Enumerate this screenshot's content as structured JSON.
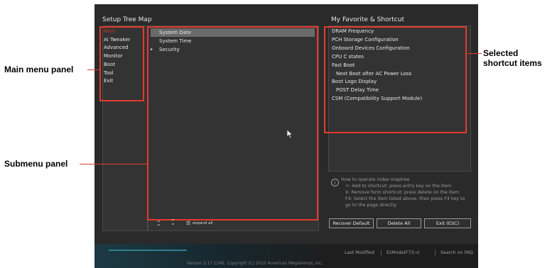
{
  "setup_tree": {
    "title": "Setup Tree Map",
    "menu": [
      "Main",
      "Ai Tweaker",
      "Advanced",
      "Monitor",
      "Boot",
      "Tool",
      "Exit"
    ],
    "submenu": [
      {
        "label": "System Date"
      },
      {
        "label": "System Time"
      },
      {
        "label": "Security",
        "arrow": "▸"
      }
    ],
    "toolbar": {
      "collapse_glyph": "≈",
      "expand_glyph": "≋",
      "expand_all_glyph": "☰",
      "expand_all_label": "expand all"
    }
  },
  "favorite": {
    "title": "My Favorite & Shortcut",
    "items": [
      {
        "label": "DRAM Frequency",
        "indent": false
      },
      {
        "label": "PCH Storage Configuration",
        "indent": false
      },
      {
        "label": "Onboard Devices Configuration",
        "indent": false
      },
      {
        "label": "CPU C states",
        "indent": false
      },
      {
        "label": "Fast Boot",
        "indent": false
      },
      {
        "label": "Next Boot after AC Power Loss",
        "indent": true
      },
      {
        "label": "Boot Logo Display",
        "indent": false
      },
      {
        "label": "POST Delay Time",
        "indent": true
      },
      {
        "label": "CSM (Compatibility Support Module)",
        "indent": false
      }
    ],
    "help": [
      "How to operate index maptree",
      "+: Add to shortcut: press entry key on the item",
      "X: Remove form shortcut: press delete on the item",
      "F4: Select the item listed above, then press F4 key to",
      "go to the page directly."
    ],
    "buttons": {
      "recover": "Recover Default",
      "delete_all": "Delete All",
      "exit": "Exit (ESC)"
    }
  },
  "footer": {
    "last_modified": "Last Modified",
    "ezmode": "EzMode(F7)|→|",
    "search": "Search on FAQ",
    "version": "Version 2.17.1246. Copyright (C) 2015 American Megatrends, Inc."
  },
  "callouts": {
    "main_menu": "Main menu panel",
    "submenu": "Submenu panel",
    "selected_line1": "Selected",
    "selected_line2": "shortcut items"
  },
  "colors": {
    "accent": "#e23b2e",
    "selected_menu": "#c03a2b",
    "background": "#2a2a2a"
  }
}
